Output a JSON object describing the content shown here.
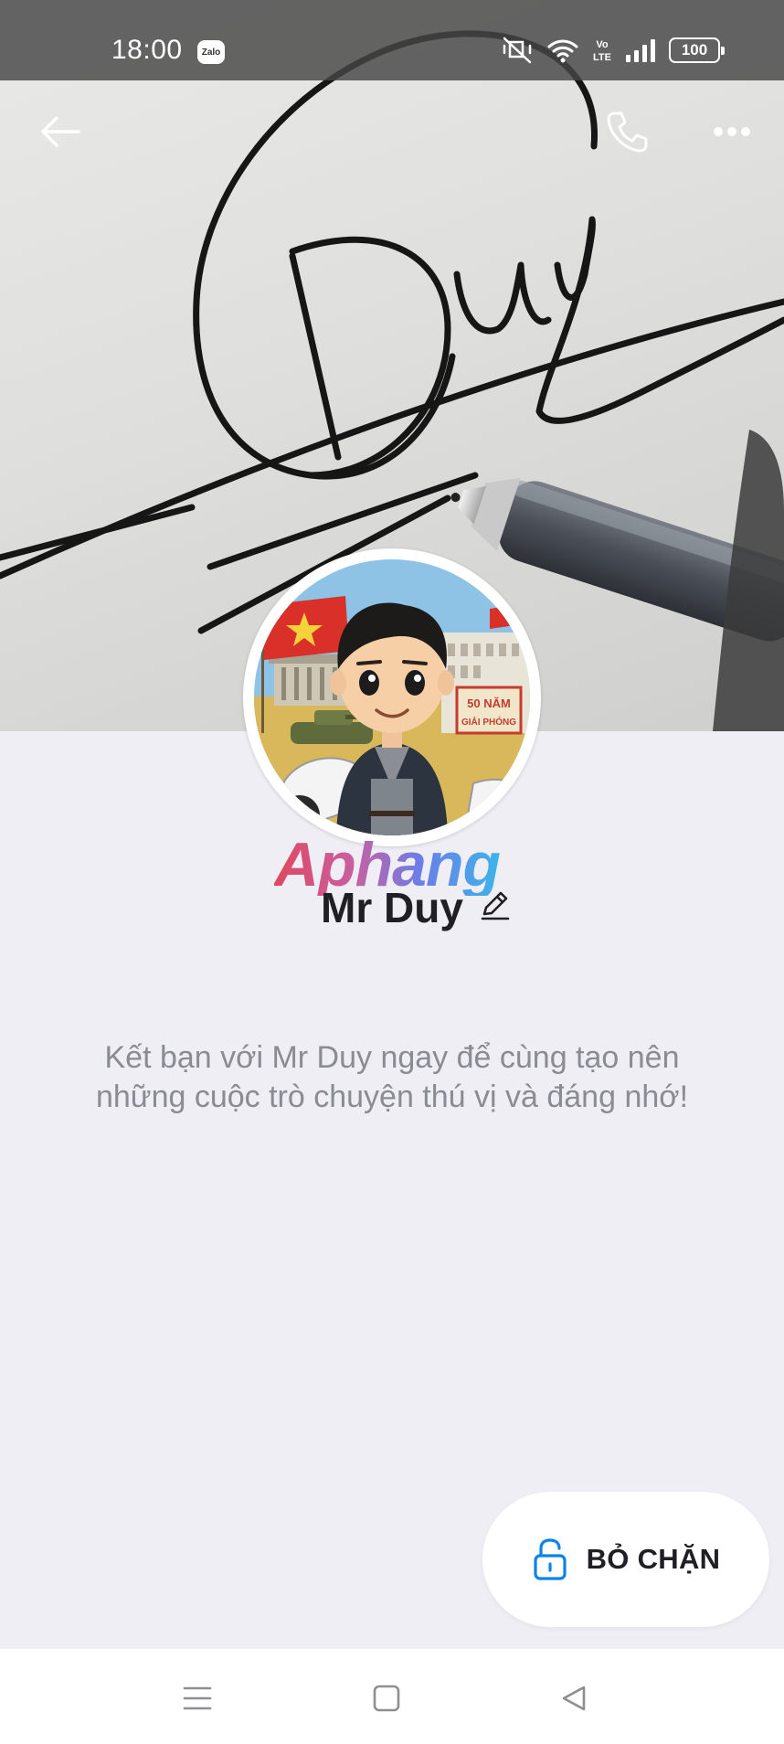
{
  "status_bar": {
    "time": "18:00",
    "app_badge": "Zalo",
    "network_label": "Vo LTE",
    "battery": "100"
  },
  "profile": {
    "watermark": "Aphang",
    "name": "Mr Duy",
    "intro": "Kết bạn với Mr Duy ngay để cùng tạo nên những cuộc trò chuyện thú vị và đáng nhớ!",
    "avatar_sign_text": "50 NĂM GIẢI PHÓNG"
  },
  "actions": {
    "unblock_label": "BỎ CHẶN"
  },
  "colors": {
    "accent": "#0a84e6",
    "background": "#efeef4",
    "muted_text": "#8b8b93"
  },
  "icons": {
    "back": "arrow-left-icon",
    "call": "phone-icon",
    "more": "more-icon",
    "edit": "pencil-icon",
    "unblock": "unlock-icon",
    "menu": "menu-icon",
    "home": "home-icon",
    "back_nav": "triangle-back-icon"
  }
}
